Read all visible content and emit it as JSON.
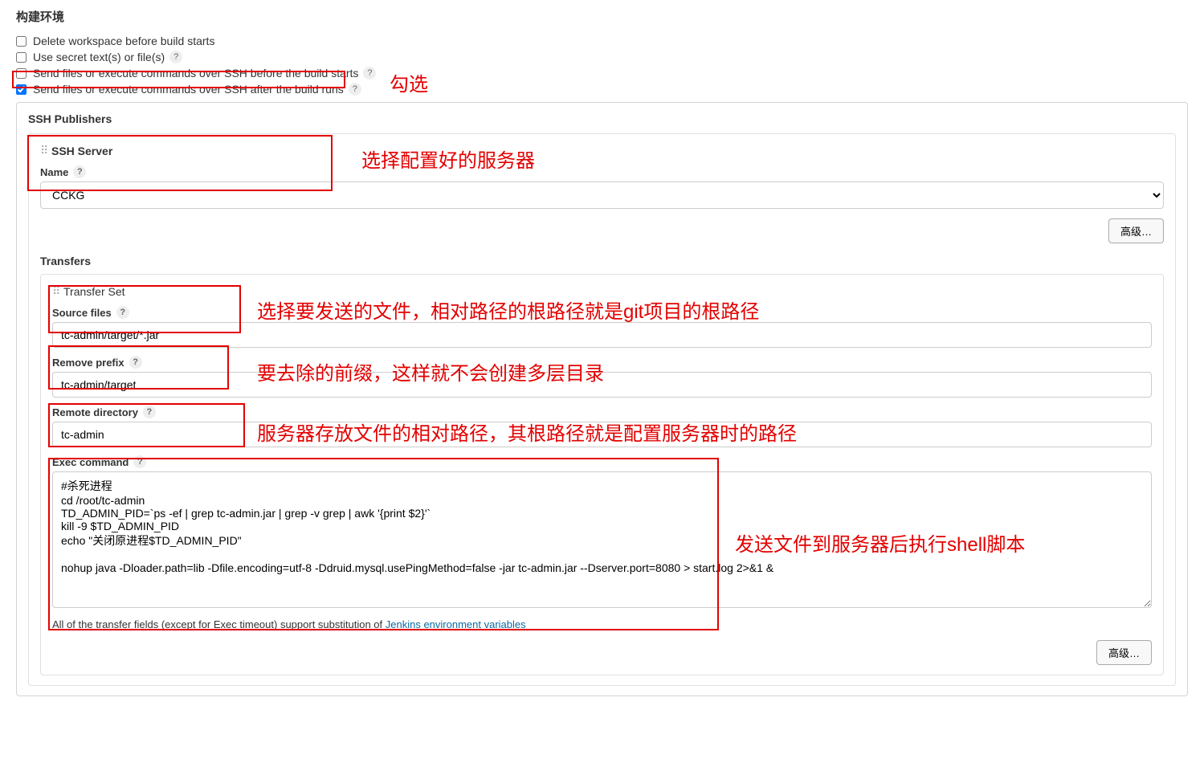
{
  "section_title": "构建环境",
  "checkboxes": {
    "delete_workspace": "Delete workspace before build starts",
    "use_secret": "Use secret text(s) or file(s)",
    "ssh_before": "Send files or execute commands over SSH before the build starts",
    "ssh_after": "Send files or execute commands over SSH after the build runs"
  },
  "ssh_publishers_title": "SSH Publishers",
  "ssh_server_title": "SSH Server",
  "name_label": "Name",
  "server_name": "CCKG",
  "advanced_btn": "高级…",
  "transfers_title": "Transfers",
  "transfer_set_title": "Transfer Set",
  "source_files_label": "Source files",
  "source_files_value": "tc-admin/target/*.jar",
  "remove_prefix_label": "Remove prefix",
  "remove_prefix_value": "tc-admin/target",
  "remote_dir_label": "Remote directory",
  "remote_dir_value": "tc-admin",
  "exec_cmd_label": "Exec command",
  "exec_cmd_value": "#杀死进程\ncd /root/tc-admin\nTD_ADMIN_PID=`ps -ef | grep tc-admin.jar | grep -v grep | awk '{print $2}'`\nkill -9 $TD_ADMIN_PID\necho \"关闭原进程$TD_ADMIN_PID\"\n\nnohup java -Dloader.path=lib -Dfile.encoding=utf-8 -Ddruid.mysql.usePingMethod=false -jar tc-admin.jar --Dserver.port=8080 > start.log 2>&1 &",
  "footer_text_prefix": "All of the transfer fields (except for Exec timeout) support substitution of ",
  "footer_link": "Jenkins environment variables",
  "annotations": {
    "check": "勾选",
    "server": "选择配置好的服务器",
    "source": "选择要发送的文件，相对路径的根路径就是git项目的根路径",
    "prefix": "要去除的前缀，这样就不会创建多层目录",
    "remote": "服务器存放文件的相对路径，其根路径就是配置服务器时的路径",
    "shell": "发送文件到服务器后执行shell脚本"
  },
  "help_q": "?"
}
